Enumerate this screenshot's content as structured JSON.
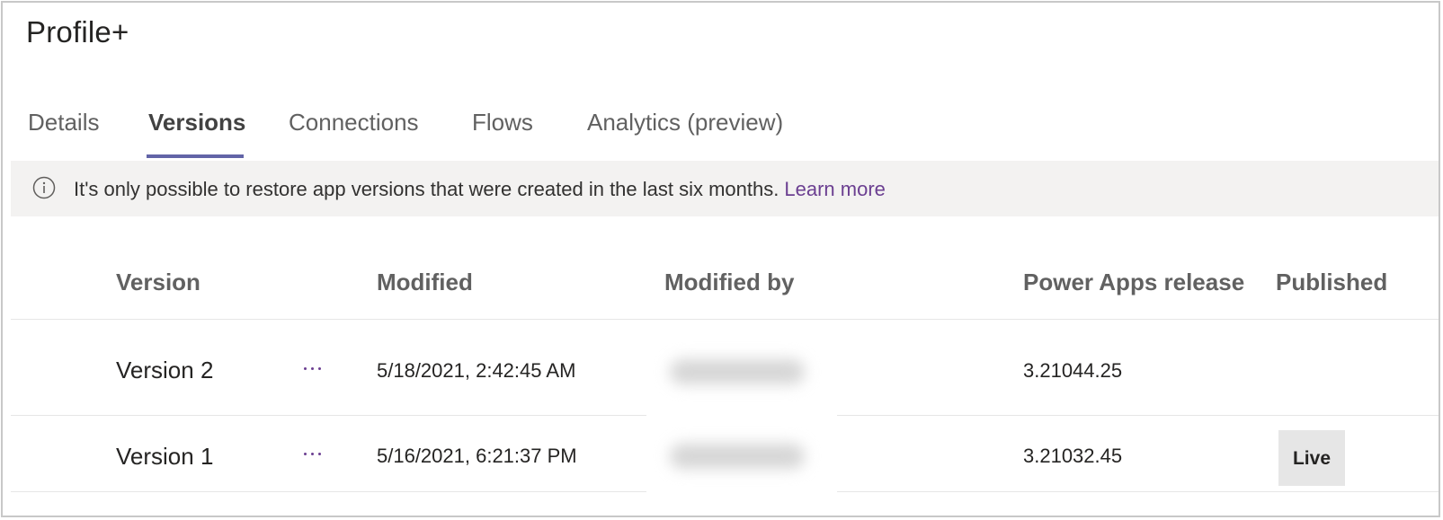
{
  "app": {
    "title": "Profile+"
  },
  "tabs": [
    {
      "label": "Details"
    },
    {
      "label": "Versions",
      "active": true
    },
    {
      "label": "Connections"
    },
    {
      "label": "Flows"
    },
    {
      "label": "Analytics (preview)"
    }
  ],
  "banner": {
    "icon": "info-icon",
    "message": "It's only possible to restore app versions that were created in the last six months.",
    "link": "Learn more"
  },
  "table": {
    "columns": [
      "Version",
      "Modified",
      "Modified by",
      "Power Apps release",
      "Published"
    ],
    "rows": [
      {
        "version": "Version 2",
        "actions_icon": "more-icon",
        "modified": "5/18/2021, 2:42:45 AM",
        "power_apps_release": "3.21044.25",
        "published": ""
      },
      {
        "version": "Version 1",
        "actions_icon": "more-icon",
        "modified": "5/16/2021, 6:21:37 PM",
        "power_apps_release": "3.21032.45",
        "published": "Live"
      }
    ]
  },
  "colors": {
    "accent": "#6264a7",
    "link": "#6b3f91",
    "banner_bg": "#f3f2f1"
  }
}
